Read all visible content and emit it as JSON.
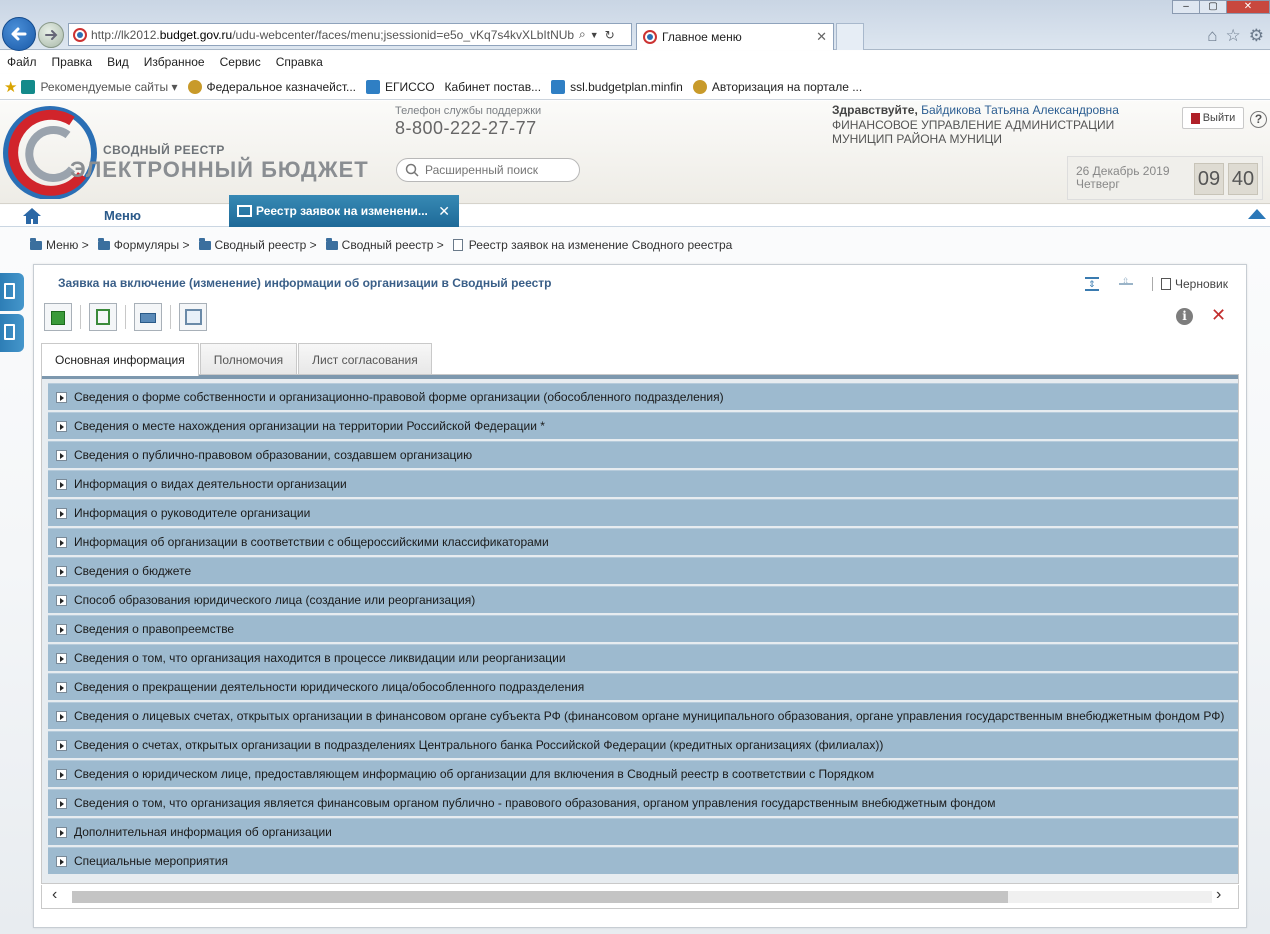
{
  "browser": {
    "url_prefix": "http://lk2012.",
    "url_domain": "budget.gov.ru",
    "url_rest": "/udu-webcenter/faces/menu;jsessionid=e5o_vKq7s4kvXLbItNUb",
    "tab_title": "Главное меню",
    "menu": [
      "Файл",
      "Правка",
      "Вид",
      "Избранное",
      "Сервис",
      "Справка"
    ],
    "favorites": [
      "Рекомендуемые сайты ▾",
      "Федеральное казначейст...",
      "ЕГИССО",
      "Кабинет постав...",
      "ssl.budgetplan.minfin",
      "Авторизация на портале ..."
    ]
  },
  "header": {
    "logo_sub": "СВОДНЫЙ РЕЕСТР",
    "logo_main": "ЭЛЕКТРОННЫЙ БЮДЖЕТ",
    "support_label": "Телефон службы поддержки",
    "support_phone": "8-800-222-27-77",
    "search_placeholder": "Расширенный поиск",
    "greeting": "Здравствуйте,",
    "user_name": "Байдикова Татьяна Александровна",
    "org_name": "ФИНАНСОВОЕ УПРАВЛЕНИЕ АДМИНИСТРАЦИИ МУНИЦИП РАЙОНА МУНИЦИ",
    "logout_label": "Выйти",
    "help_label": "?",
    "date": "26 Декабрь 2019",
    "weekday": "Четверг",
    "hours": "09",
    "minutes": "40"
  },
  "nav": {
    "menu_label": "Меню",
    "active_tab": "Реестр заявок на изменени..."
  },
  "breadcrumb": [
    "Меню >",
    "Формуляры >",
    "Сводный реестр >",
    "Сводный реестр >",
    "Реестр заявок на изменение Сводного реестра"
  ],
  "panel": {
    "title": "Заявка на включение (изменение) информации об организации в Сводный реестр",
    "draft_label": "Черновик",
    "tabs": [
      "Основная информация",
      "Полномочия",
      "Лист согласования"
    ],
    "sections": [
      "Сведения о форме собственности и организационно-правовой форме организации (обособленного подразделения)",
      "Сведения о месте нахождения организации на территории Российской Федерации *",
      "Сведения о публично-правовом образовании, создавшем организацию",
      "Информация о видах деятельности организации",
      "Информация о руководителе организации",
      "Информация об организации в соответствии с общероссийскими классификаторами",
      "Сведения о бюджете",
      "Способ образования юридического лица (создание или реорганизация)",
      "Сведения о правопреемстве",
      "Сведения о том, что организация находится в процессе ликвидации или реорганизации",
      "Сведения о прекращении деятельности юридического лица/обособленного подразделения",
      "Сведения о лицевых счетах, открытых организации в финансовом органе субъекта РФ (финансовом органе муниципального образования, органе управления государственным внебюджетным фондом РФ)",
      "Сведения о счетах, открытых организации в подразделениях Центрального банка Российской Федерации (кредитных организациях (филиалах))",
      "Сведения о юридическом лице, предоставляющем информацию об организации для включения в Сводный реестр в соответствии с Порядком",
      "Сведения о том, что организация является финансовым органом публично - правового образования, органом управления государственным внебюджетным фондом",
      "Дополнительная информация об организации",
      "Специальные мероприятия"
    ]
  },
  "colors": {
    "accent": "#1e6a98",
    "section_bg": "#9dbacf",
    "title": "#3a5f88",
    "close_red": "#c22d2d"
  }
}
